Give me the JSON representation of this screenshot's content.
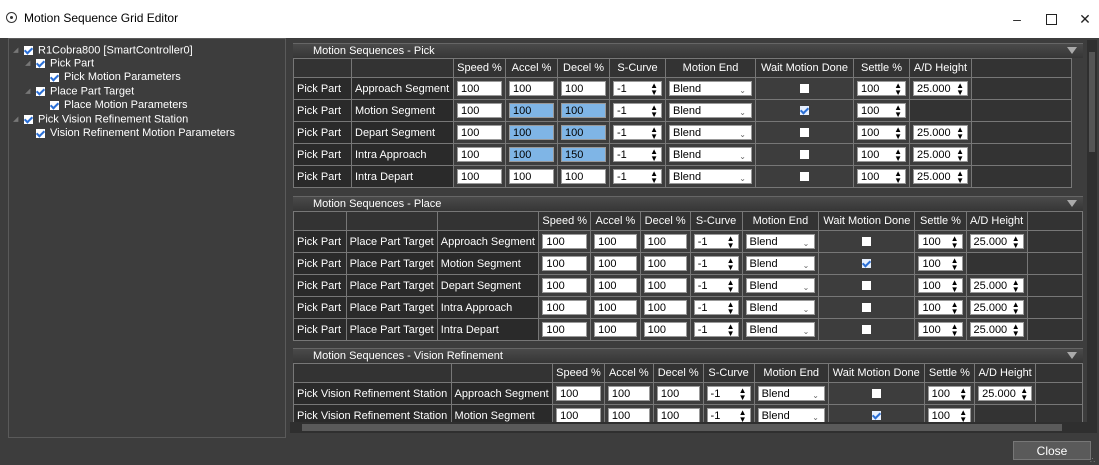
{
  "window": {
    "title": "Motion Sequence Grid Editor",
    "close_label": "Close"
  },
  "tree": [
    {
      "label": "R1Cobra800 [SmartController0]",
      "level": 0,
      "expander": true
    },
    {
      "label": "Pick Part",
      "level": 1,
      "expander": true
    },
    {
      "label": "Pick Motion Parameters",
      "level": 2,
      "expander": false
    },
    {
      "label": "Place Part Target",
      "level": 1,
      "expander": true
    },
    {
      "label": "Place Motion Parameters",
      "level": 2,
      "expander": false
    },
    {
      "label": "Pick Vision Refinement Station",
      "level": 0,
      "expander": true
    },
    {
      "label": "Vision Refinement Motion Parameters",
      "level": 1,
      "expander": false
    }
  ],
  "columns": {
    "speed": "Speed %",
    "accel": "Accel %",
    "decel": "Decel %",
    "scurve": "S-Curve",
    "motion_end": "Motion End",
    "wait": "Wait Motion Done",
    "settle": "Settle %",
    "ad": "A/D Height"
  },
  "sections": [
    {
      "title": "Motion Sequences - Pick",
      "rows": [
        {
          "c1": "Pick Part",
          "c2": "",
          "seg": "Approach Segment",
          "speed": "100",
          "accel": "100",
          "decel": "100",
          "scurve": "-1",
          "end": "Blend",
          "wait": false,
          "settle": "100",
          "ad": "25.000",
          "sel": false
        },
        {
          "c1": "Pick Part",
          "c2": "",
          "seg": "Motion Segment",
          "speed": "100",
          "accel": "100",
          "decel": "100",
          "scurve": "-1",
          "end": "Blend",
          "wait": true,
          "settle": "100",
          "ad": "",
          "sel": true
        },
        {
          "c1": "Pick Part",
          "c2": "",
          "seg": "Depart Segment",
          "speed": "100",
          "accel": "100",
          "decel": "100",
          "scurve": "-1",
          "end": "Blend",
          "wait": false,
          "settle": "100",
          "ad": "25.000",
          "sel": true
        },
        {
          "c1": "Pick Part",
          "c2": "",
          "seg": "Intra Approach",
          "speed": "100",
          "accel": "100",
          "decel": "150",
          "scurve": "-1",
          "end": "Blend",
          "wait": false,
          "settle": "100",
          "ad": "25.000",
          "sel": true
        },
        {
          "c1": "Pick Part",
          "c2": "",
          "seg": "Intra Depart",
          "speed": "100",
          "accel": "100",
          "decel": "100",
          "scurve": "-1",
          "end": "Blend",
          "wait": false,
          "settle": "100",
          "ad": "25.000",
          "sel": false
        }
      ]
    },
    {
      "title": "Motion Sequences - Place",
      "rows": [
        {
          "c1": "Pick Part",
          "c2": "Place Part Target",
          "seg": "Approach Segment",
          "speed": "100",
          "accel": "100",
          "decel": "100",
          "scurve": "-1",
          "end": "Blend",
          "wait": false,
          "settle": "100",
          "ad": "25.000",
          "sel": false
        },
        {
          "c1": "Pick Part",
          "c2": "Place Part Target",
          "seg": "Motion Segment",
          "speed": "100",
          "accel": "100",
          "decel": "100",
          "scurve": "-1",
          "end": "Blend",
          "wait": true,
          "settle": "100",
          "ad": "",
          "sel": false
        },
        {
          "c1": "Pick Part",
          "c2": "Place Part Target",
          "seg": "Depart Segment",
          "speed": "100",
          "accel": "100",
          "decel": "100",
          "scurve": "-1",
          "end": "Blend",
          "wait": false,
          "settle": "100",
          "ad": "25.000",
          "sel": false
        },
        {
          "c1": "Pick Part",
          "c2": "Place Part Target",
          "seg": "Intra Approach",
          "speed": "100",
          "accel": "100",
          "decel": "100",
          "scurve": "-1",
          "end": "Blend",
          "wait": false,
          "settle": "100",
          "ad": "25.000",
          "sel": false
        },
        {
          "c1": "Pick Part",
          "c2": "Place Part Target",
          "seg": "Intra Depart",
          "speed": "100",
          "accel": "100",
          "decel": "100",
          "scurve": "-1",
          "end": "Blend",
          "wait": false,
          "settle": "100",
          "ad": "25.000",
          "sel": false
        }
      ]
    },
    {
      "title": "Motion Sequences - Vision Refinement",
      "rows": [
        {
          "c1": "Pick Vision Refinement Station",
          "c2": "",
          "seg": "Approach Segment",
          "speed": "100",
          "accel": "100",
          "decel": "100",
          "scurve": "-1",
          "end": "Blend",
          "wait": false,
          "settle": "100",
          "ad": "25.000",
          "sel": false
        },
        {
          "c1": "Pick Vision Refinement Station",
          "c2": "",
          "seg": "Motion Segment",
          "speed": "100",
          "accel": "100",
          "decel": "100",
          "scurve": "-1",
          "end": "Blend",
          "wait": true,
          "settle": "100",
          "ad": "",
          "sel": false
        }
      ]
    }
  ]
}
